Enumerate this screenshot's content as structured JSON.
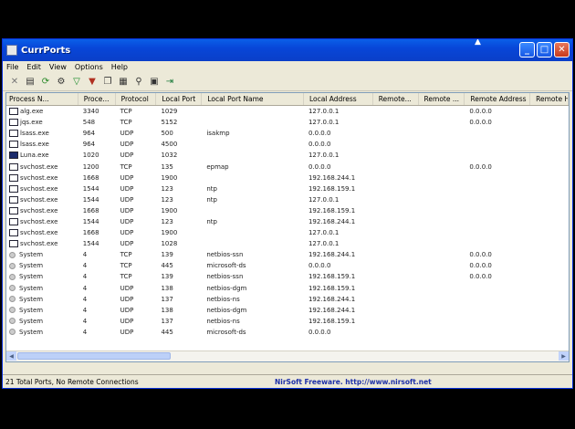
{
  "window": {
    "title": "CurrPorts"
  },
  "menu": [
    "File",
    "Edit",
    "View",
    "Options",
    "Help"
  ],
  "toolbar_icons": [
    "close-connection-icon",
    "save-icon",
    "refresh-icon",
    "properties-icon",
    "filter-icon",
    "advanced-filter-icon",
    "copy-icon",
    "html-report-icon",
    "find-icon",
    "report-icon",
    "exit-icon"
  ],
  "columns": [
    "Process N...",
    "Proce...",
    "Protocol",
    "Local Port",
    "Local Port Name",
    "Local Address",
    "Remote...",
    "Remote ...",
    "Remote Address",
    "Remote Ho"
  ],
  "rows": [
    {
      "icon": "app",
      "c": [
        "alg.exe",
        "3340",
        "TCP",
        "1029",
        "",
        "127.0.0.1",
        "",
        "",
        "0.0.0.0",
        ""
      ]
    },
    {
      "icon": "app",
      "c": [
        "jqs.exe",
        "548",
        "TCP",
        "5152",
        "",
        "127.0.0.1",
        "",
        "",
        "0.0.0.0",
        ""
      ]
    },
    {
      "icon": "app",
      "c": [
        "lsass.exe",
        "964",
        "UDP",
        "500",
        "isakmp",
        "0.0.0.0",
        "",
        "",
        "",
        ""
      ]
    },
    {
      "icon": "app",
      "c": [
        "lsass.exe",
        "964",
        "UDP",
        "4500",
        "",
        "0.0.0.0",
        "",
        "",
        "",
        ""
      ]
    },
    {
      "icon": "lsass",
      "c": [
        "Luna.exe",
        "1020",
        "UDP",
        "1032",
        "",
        "127.0.0.1",
        "",
        "",
        "",
        ""
      ]
    },
    {
      "icon": "app",
      "c": [
        "svchost.exe",
        "1200",
        "TCP",
        "135",
        "epmap",
        "0.0.0.0",
        "",
        "",
        "0.0.0.0",
        ""
      ]
    },
    {
      "icon": "app",
      "c": [
        "svchost.exe",
        "1668",
        "UDP",
        "1900",
        "",
        "192.168.244.1",
        "",
        "",
        "",
        ""
      ]
    },
    {
      "icon": "app",
      "c": [
        "svchost.exe",
        "1544",
        "UDP",
        "123",
        "ntp",
        "192.168.159.1",
        "",
        "",
        "",
        ""
      ]
    },
    {
      "icon": "app",
      "c": [
        "svchost.exe",
        "1544",
        "UDP",
        "123",
        "ntp",
        "127.0.0.1",
        "",
        "",
        "",
        ""
      ]
    },
    {
      "icon": "app",
      "c": [
        "svchost.exe",
        "1668",
        "UDP",
        "1900",
        "",
        "192.168.159.1",
        "",
        "",
        "",
        ""
      ]
    },
    {
      "icon": "app",
      "c": [
        "svchost.exe",
        "1544",
        "UDP",
        "123",
        "ntp",
        "192.168.244.1",
        "",
        "",
        "",
        ""
      ]
    },
    {
      "icon": "app",
      "c": [
        "svchost.exe",
        "1668",
        "UDP",
        "1900",
        "",
        "127.0.0.1",
        "",
        "",
        "",
        ""
      ]
    },
    {
      "icon": "app",
      "c": [
        "svchost.exe",
        "1544",
        "UDP",
        "1028",
        "",
        "127.0.0.1",
        "",
        "",
        "",
        ""
      ]
    },
    {
      "icon": "sys",
      "c": [
        "System",
        "4",
        "TCP",
        "139",
        "netbios-ssn",
        "192.168.244.1",
        "",
        "",
        "0.0.0.0",
        ""
      ]
    },
    {
      "icon": "sys",
      "c": [
        "System",
        "4",
        "TCP",
        "445",
        "microsoft-ds",
        "0.0.0.0",
        "",
        "",
        "0.0.0.0",
        ""
      ]
    },
    {
      "icon": "sys",
      "c": [
        "System",
        "4",
        "TCP",
        "139",
        "netbios-ssn",
        "192.168.159.1",
        "",
        "",
        "0.0.0.0",
        ""
      ]
    },
    {
      "icon": "sys",
      "c": [
        "System",
        "4",
        "UDP",
        "138",
        "netbios-dgm",
        "192.168.159.1",
        "",
        "",
        "",
        ""
      ]
    },
    {
      "icon": "sys",
      "c": [
        "System",
        "4",
        "UDP",
        "137",
        "netbios-ns",
        "192.168.244.1",
        "",
        "",
        "",
        ""
      ]
    },
    {
      "icon": "sys",
      "c": [
        "System",
        "4",
        "UDP",
        "138",
        "netbios-dgm",
        "192.168.244.1",
        "",
        "",
        "",
        ""
      ]
    },
    {
      "icon": "sys",
      "c": [
        "System",
        "4",
        "UDP",
        "137",
        "netbios-ns",
        "192.168.159.1",
        "",
        "",
        "",
        ""
      ]
    },
    {
      "icon": "sys",
      "c": [
        "System",
        "4",
        "UDP",
        "445",
        "microsoft-ds",
        "0.0.0.0",
        "",
        "",
        "",
        ""
      ]
    }
  ],
  "status": {
    "left": "21 Total Ports, No Remote Connections",
    "right": "NirSoft Freeware.  http://www.nirsoft.net"
  }
}
